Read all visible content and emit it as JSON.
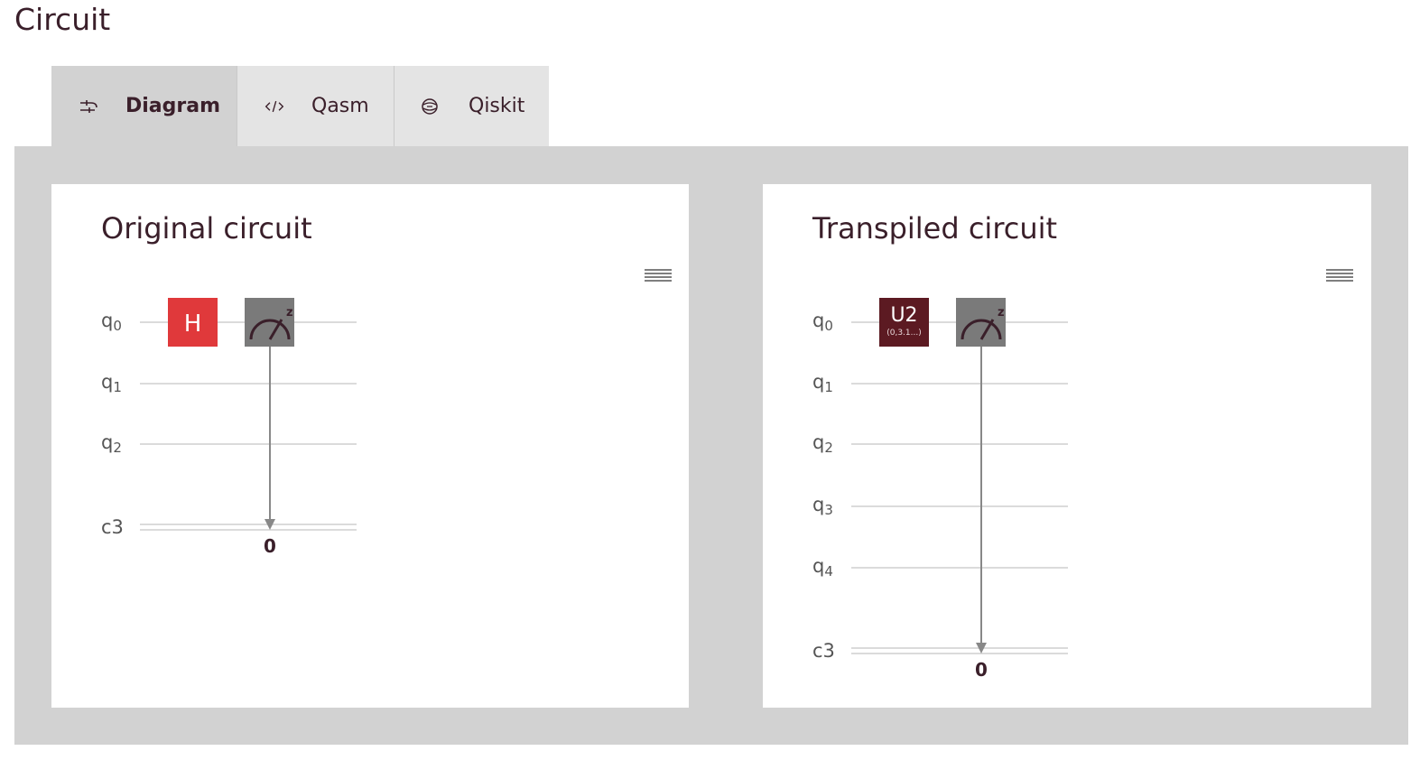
{
  "section_title": "Circuit",
  "tabs": [
    {
      "label": "Diagram",
      "icon": "diagram-icon",
      "active": true
    },
    {
      "label": "Qasm",
      "icon": "code-icon",
      "active": false
    },
    {
      "label": "Qiskit",
      "icon": "qiskit-icon",
      "active": false
    }
  ],
  "original": {
    "title": "Original circuit",
    "menu_icon": "hamburger-menu-icon",
    "wires": [
      {
        "prefix": "q",
        "sub": "0"
      },
      {
        "prefix": "q",
        "sub": "1"
      },
      {
        "prefix": "q",
        "sub": "2"
      },
      {
        "prefix": "c3",
        "sub": ""
      }
    ],
    "gate_label": "H",
    "measure_label": "z",
    "classical_bit": "0"
  },
  "transpiled": {
    "title": "Transpiled circuit",
    "menu_icon": "hamburger-menu-icon",
    "wires": [
      {
        "prefix": "q",
        "sub": "0"
      },
      {
        "prefix": "q",
        "sub": "1"
      },
      {
        "prefix": "q",
        "sub": "2"
      },
      {
        "prefix": "q",
        "sub": "3"
      },
      {
        "prefix": "q",
        "sub": "4"
      },
      {
        "prefix": "c3",
        "sub": ""
      }
    ],
    "gate_label": "U2",
    "gate_params": "(0,3.1...)",
    "measure_label": "z",
    "classical_bit": "0"
  },
  "colors": {
    "h_gate": "#e0393b",
    "u2_gate": "#5c1a22",
    "measure_gate": "#7a7a7a",
    "wire": "#cfcfcf",
    "text": "#3a1f2a"
  }
}
